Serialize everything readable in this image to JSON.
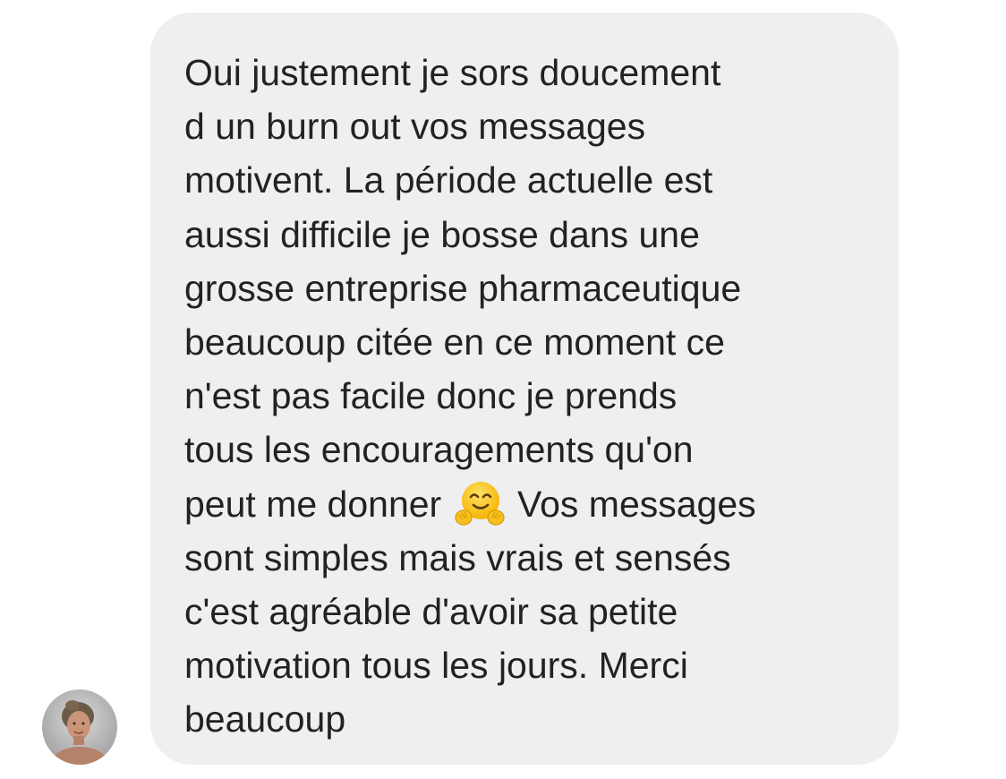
{
  "message": {
    "lines": [
      "Oui justement je sors doucement",
      "d un burn out vos messages",
      "motivent. La période actuelle est",
      "aussi difficile je bosse dans une",
      "grosse entreprise pharmaceutique",
      "beaucoup citée en ce moment ce",
      "n'est pas facile donc je prends",
      "tous les encouragements qu'on"
    ],
    "line_with_emoji_before": "peut me donner",
    "line_with_emoji_after": "Vos messages",
    "lines_after": [
      "sont simples mais vrais et sensés",
      "c'est agréable d'avoir sa petite",
      "motivation tous les jours.  Merci",
      "beaucoup"
    ],
    "emoji": "hugging-face-icon"
  },
  "sender": {
    "avatar": "avatar-photo"
  },
  "colors": {
    "bubble_background": "#efefef",
    "text": "#222222",
    "page_background": "#ffffff"
  }
}
